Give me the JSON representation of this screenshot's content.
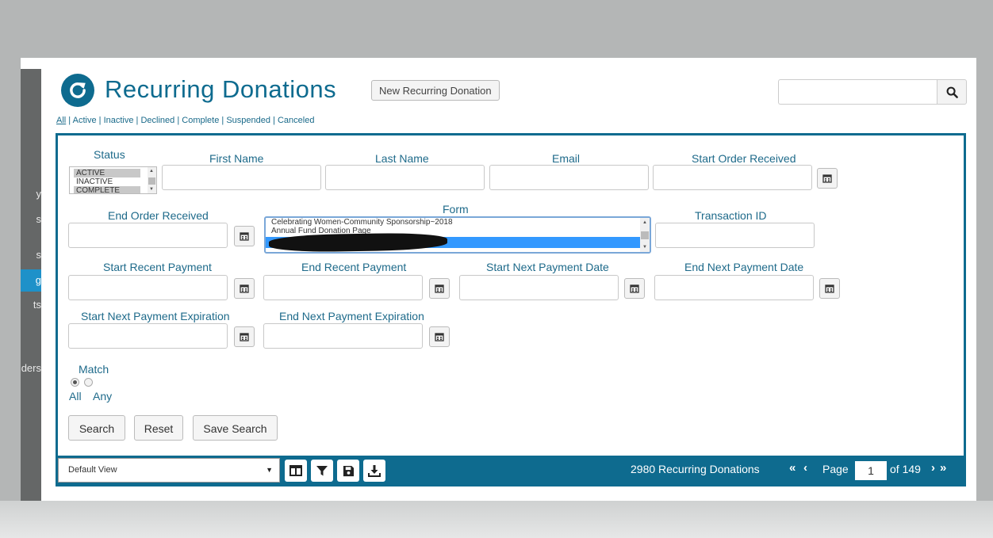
{
  "sidebar": {
    "items": [
      {
        "label": "y",
        "active": false
      },
      {
        "label": "s",
        "active": false
      },
      {
        "label": "s",
        "active": false
      },
      {
        "label": "g",
        "active": true
      },
      {
        "label": "ts",
        "active": false
      },
      {
        "label": "ders",
        "active": false
      }
    ]
  },
  "header": {
    "title": "Recurring Donations",
    "new_button": "New Recurring Donation",
    "search_placeholder": ""
  },
  "filter_links": [
    "All",
    "Active",
    "Inactive",
    "Declined",
    "Complete",
    "Suspended",
    "Canceled"
  ],
  "form": {
    "status_label": "Status",
    "status_options": [
      "ACTIVE",
      "INACTIVE",
      "COMPLETE"
    ],
    "first_name_label": "First Name",
    "last_name_label": "Last Name",
    "email_label": "Email",
    "start_order_received_label": "Start Order Received",
    "end_order_received_label": "End Order Received",
    "form_label": "Form",
    "form_options": [
      "Celebrating Women-Community Sponsorship~2018",
      "Annual Fund Donation Page",
      ""
    ],
    "transaction_id_label": "Transaction ID",
    "start_recent_payment_label": "Start Recent Payment",
    "end_recent_payment_label": "End Recent Payment",
    "start_next_payment_date_label": "Start Next Payment Date",
    "end_next_payment_date_label": "End Next Payment Date",
    "start_next_payment_expiration_label": "Start Next Payment Expiration",
    "end_next_payment_expiration_label": "End Next Payment Expiration",
    "match_label": "Match",
    "match_all": "All",
    "match_any": "Any",
    "search_button": "Search",
    "reset_button": "Reset",
    "save_search_button": "Save Search"
  },
  "footer": {
    "view_select": "Default View",
    "count_text": "2980 Recurring Donations",
    "page_label": "Page",
    "page_value": "1",
    "page_total": "of 149"
  },
  "colors": {
    "accent": "#0e6b8f",
    "sidebar_active": "#1e91c9",
    "sidebar": "#656767"
  }
}
